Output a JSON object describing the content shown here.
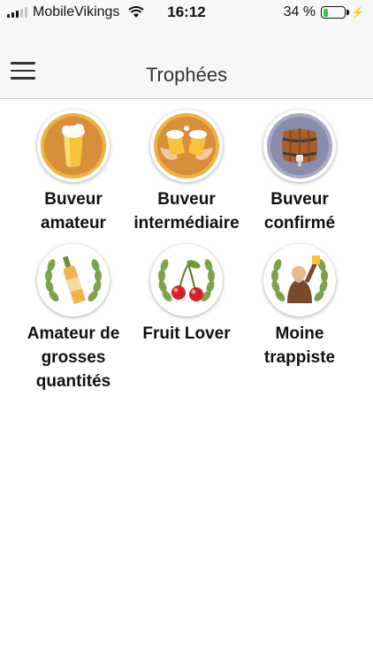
{
  "status_bar": {
    "carrier": "MobileVikings",
    "time": "16:12",
    "battery": "34 %",
    "battery_level": 0.34
  },
  "header": {
    "title": "Trophées"
  },
  "trophies": [
    {
      "label": "Buveur amateur",
      "icon": "beer-glass-icon"
    },
    {
      "label": "Buveur intermédiaire",
      "icon": "cheers-icon"
    },
    {
      "label": "Buveur confirmé",
      "icon": "barrel-icon"
    },
    {
      "label": "Amateur de grosses quantités",
      "icon": "bottle-laurel-icon"
    },
    {
      "label": "Fruit Lover",
      "icon": "cherries-laurel-icon"
    },
    {
      "label": "Moine trappiste",
      "icon": "monk-laurel-icon"
    }
  ]
}
